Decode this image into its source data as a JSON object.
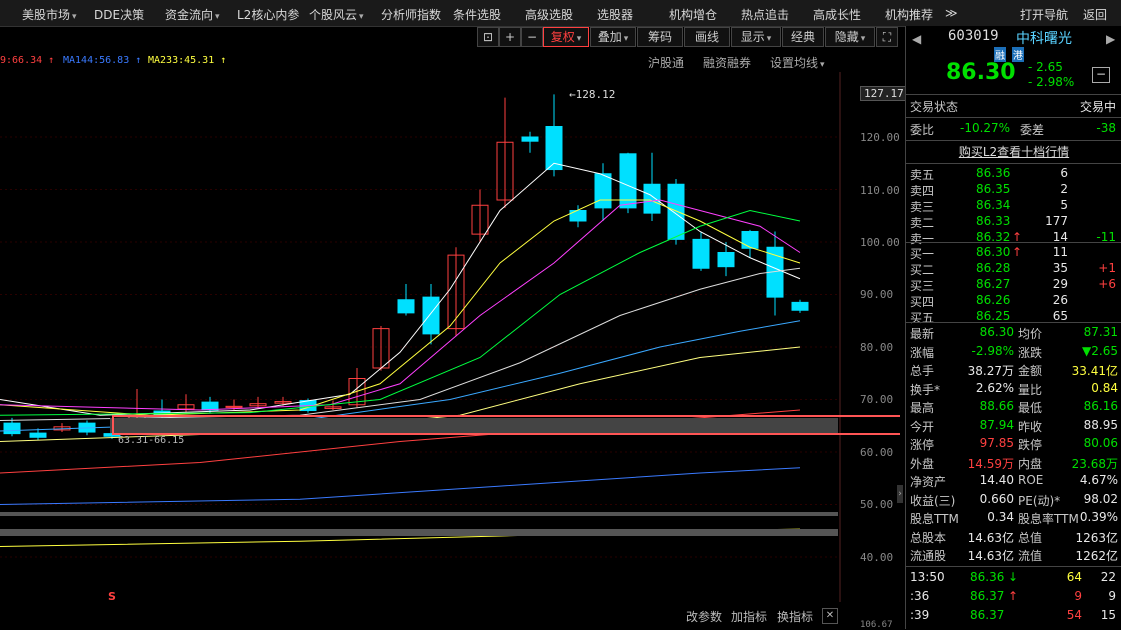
{
  "menu": {
    "items": [
      "美股市场",
      "DDE决策",
      "资金流向",
      "L2核心内参",
      "个股风云",
      "分析师指数",
      "条件选股",
      "高级选股",
      "选股器",
      "机构增仓",
      "热点追击",
      "高成长性",
      "机构推荐",
      "≫",
      "打开导航",
      "返回"
    ],
    "dropdown_flags": [
      true,
      false,
      true,
      false,
      true,
      false,
      false,
      false,
      false,
      false,
      false,
      false,
      false,
      false,
      false,
      false
    ]
  },
  "toolbar": {
    "buttons": [
      "复权",
      "叠加",
      "筹码",
      "画线",
      "显示",
      "经典",
      "隐藏"
    ],
    "dropdown_flags": [
      true,
      true,
      false,
      false,
      true,
      false,
      true
    ]
  },
  "ma_legend": [
    {
      "text": "9:66.34",
      "color": "#ff4040"
    },
    {
      "text": "MA144:56.83",
      "color": "#3a7aff"
    },
    {
      "text": "MA233:45.31",
      "color": "#ffff40"
    }
  ],
  "subnav": {
    "items": [
      "沪股通",
      "融资融券",
      "设置均线"
    ]
  },
  "chart_data": {
    "type": "candlestick",
    "yticks": [
      "127.17",
      "120.00",
      "110.00",
      "100.00",
      "90.00",
      "80.00",
      "70.00",
      "60.00",
      "50.00",
      "40.00",
      "106.67"
    ],
    "annotations": {
      "high": "128.12",
      "low": "63.31-66.15",
      "marker": "S"
    }
  },
  "stock": {
    "code": "603019",
    "name": "中科曙光",
    "tags": [
      "融",
      "港"
    ],
    "price": "86.30",
    "change": "- 2.65",
    "change_pct": "- 2.98%",
    "minus_icon": "−"
  },
  "status": {
    "label": "交易状态",
    "value": "交易中"
  },
  "ratio": {
    "label1": "委比",
    "value1": "-10.27%",
    "label2": "委差",
    "value2": "-38"
  },
  "l2_link": "购买L2查看十档行情",
  "asks": [
    {
      "label": "卖五",
      "price": "86.36",
      "vol": "6",
      "arrow": "",
      "delta": ""
    },
    {
      "label": "卖四",
      "price": "86.35",
      "vol": "2",
      "arrow": "",
      "delta": ""
    },
    {
      "label": "卖三",
      "price": "86.34",
      "vol": "5",
      "arrow": "",
      "delta": ""
    },
    {
      "label": "卖二",
      "price": "86.33",
      "vol": "177",
      "arrow": "",
      "delta": ""
    },
    {
      "label": "卖一",
      "price": "86.32",
      "vol": "14",
      "arrow": "↑",
      "delta": "-11"
    }
  ],
  "bids": [
    {
      "label": "买一",
      "price": "86.30",
      "vol": "11",
      "arrow": "↑",
      "delta": ""
    },
    {
      "label": "买二",
      "price": "86.28",
      "vol": "35",
      "arrow": "",
      "delta": "+1"
    },
    {
      "label": "买三",
      "price": "86.27",
      "vol": "29",
      "arrow": "",
      "delta": "+6"
    },
    {
      "label": "买四",
      "price": "86.26",
      "vol": "26",
      "arrow": "",
      "delta": ""
    },
    {
      "label": "买五",
      "price": "86.25",
      "vol": "65",
      "arrow": "",
      "delta": ""
    }
  ],
  "stats": [
    {
      "l1": "最新",
      "v1": "86.30",
      "c1": "green",
      "l2": "均价",
      "v2": "87.31",
      "c2": "green"
    },
    {
      "l1": "涨幅",
      "v1": "-2.98%",
      "c1": "green",
      "l2": "涨跌",
      "v2": "▼2.65",
      "c2": "green"
    },
    {
      "l1": "总手",
      "v1": "38.27万",
      "c1": "white",
      "l2": "金额",
      "v2": "33.41亿",
      "c2": "yellow"
    },
    {
      "l1": "换手*",
      "v1": "2.62%",
      "c1": "white",
      "l2": "量比",
      "v2": "0.84",
      "c2": "yellow"
    },
    {
      "l1": "最高",
      "v1": "88.66",
      "c1": "green",
      "l2": "最低",
      "v2": "86.16",
      "c2": "green"
    },
    {
      "l1": "今开",
      "v1": "87.94",
      "c1": "green",
      "l2": "昨收",
      "v2": "88.95",
      "c2": "white"
    },
    {
      "l1": "涨停",
      "v1": "97.85",
      "c1": "red",
      "l2": "跌停",
      "v2": "80.06",
      "c2": "green"
    },
    {
      "l1": "外盘",
      "v1": "14.59万",
      "c1": "red",
      "l2": "内盘",
      "v2": "23.68万",
      "c2": "green"
    },
    {
      "l1": "净资产",
      "v1": "14.40",
      "c1": "white",
      "l2": "ROE",
      "v2": "4.67%",
      "c2": "white"
    },
    {
      "l1": "收益(三)",
      "v1": "0.660",
      "c1": "white",
      "l2": "PE(动)*",
      "v2": "98.02",
      "c2": "white"
    },
    {
      "l1": "股息TTM",
      "v1": "0.34",
      "c1": "white",
      "l2": "股息率TTM",
      "v2": "0.39%",
      "c2": "white"
    },
    {
      "l1": "总股本",
      "v1": "14.63亿",
      "c1": "white",
      "l2": "总值",
      "v2": "1263亿",
      "c2": "white"
    },
    {
      "l1": "流通股",
      "v1": "14.63亿",
      "c1": "white",
      "l2": "流值",
      "v2": "1262亿",
      "c2": "white"
    }
  ],
  "ticks": [
    {
      "time": "13:50",
      "price": "86.36",
      "arrow": "↓",
      "vol": "64",
      "num": "22",
      "pc": "green",
      "ac": "green",
      "vc": "yellow"
    },
    {
      "time": ":36",
      "price": "86.37",
      "arrow": "↑",
      "vol": "9",
      "num": "9",
      "pc": "green",
      "ac": "red",
      "vc": "red"
    },
    {
      "time": ":39",
      "price": "86.37",
      "arrow": "",
      "vol": "54",
      "num": "15",
      "pc": "green",
      "ac": "",
      "vc": "red"
    }
  ],
  "bottom": [
    "改参数",
    "加指标",
    "换指标"
  ],
  "colors": {
    "up": "#ff4040",
    "down": "#00e0ff",
    "accent": "#ff4040"
  }
}
